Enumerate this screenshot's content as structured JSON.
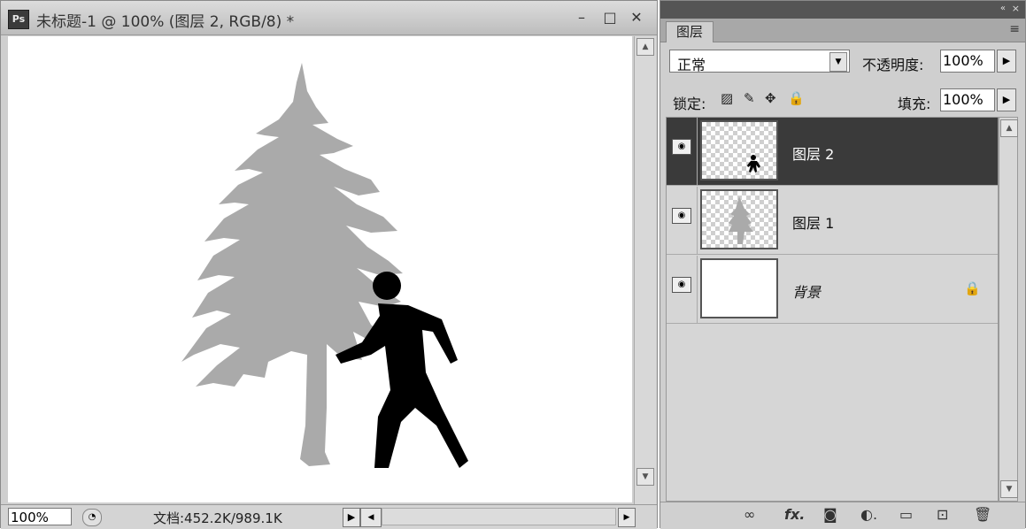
{
  "document": {
    "app_icon": "Ps",
    "title": "未标题-1 @ 100% (图层 2, RGB/8) *",
    "minimize_icon": "minimize-icon",
    "restore_icon": "restore-icon",
    "close_icon": "close-icon",
    "status": {
      "zoom": "100%",
      "doc_info": "文档:452.2K/989.1K"
    }
  },
  "layers_panel": {
    "tab": "图层",
    "blend_mode": "正常",
    "opacity_label": "不透明度:",
    "opacity": "100%",
    "lock_label": "锁定:",
    "fill_label": "填充:",
    "fill": "100%",
    "layers": [
      {
        "name": "图层 2",
        "visible": true,
        "selected": true
      },
      {
        "name": "图层 1",
        "visible": true,
        "selected": false
      },
      {
        "name": "背景",
        "visible": true,
        "selected": false,
        "locked": true
      }
    ],
    "footer_icons": [
      "link-layers-icon",
      "fx-icon",
      "layer-mask-icon",
      "adjustment-layer-icon",
      "new-group-icon",
      "new-layer-icon",
      "delete-layer-icon"
    ]
  },
  "colors": {
    "selected_layer": "#3a3a3a",
    "tree": "#aaaaaa",
    "person": "#000000"
  }
}
